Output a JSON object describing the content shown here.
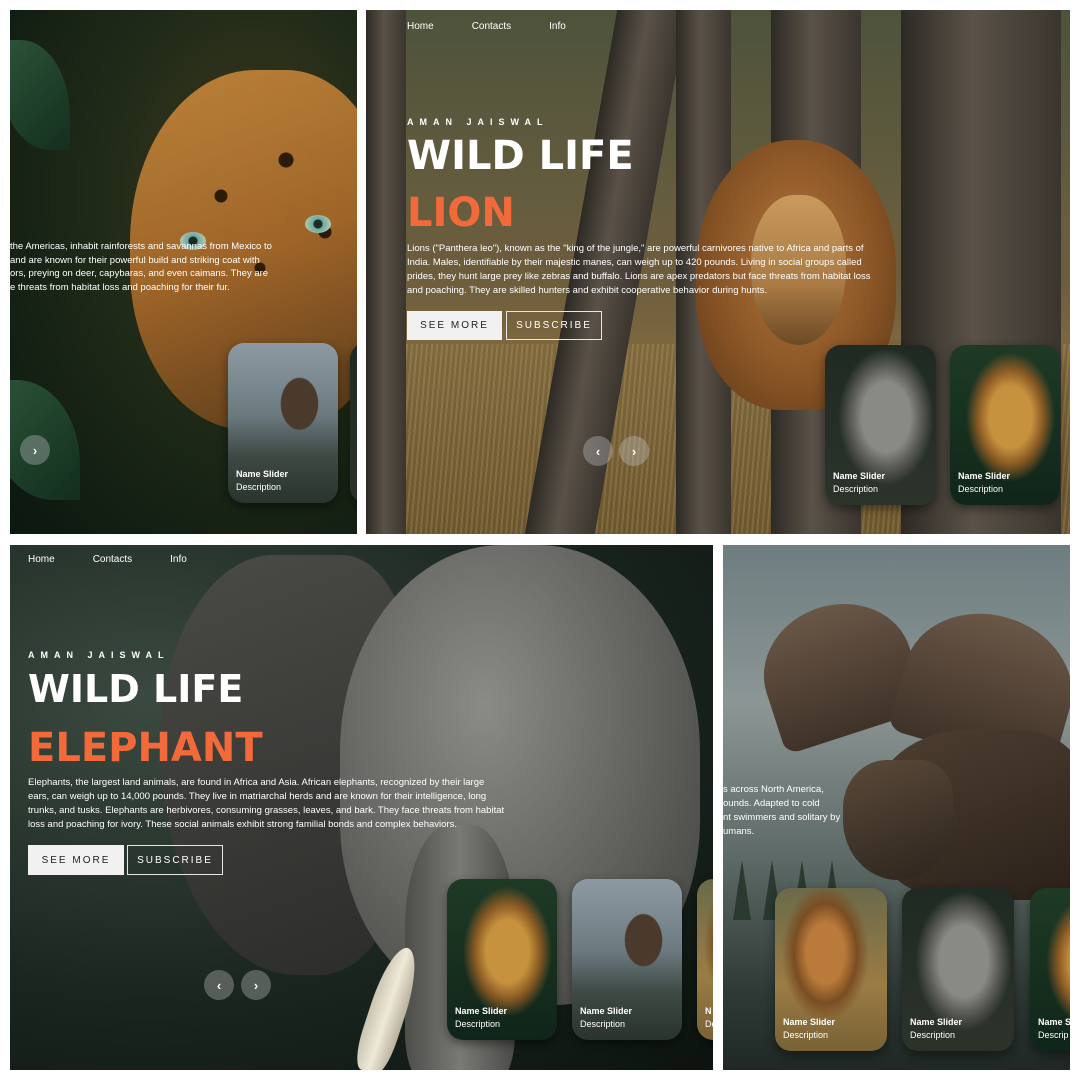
{
  "nav": {
    "home": "Home",
    "contacts": "Contacts",
    "info": "Info"
  },
  "hero": {
    "author": "AMAN JAISWAL",
    "title": "WILD LIFE",
    "see_more": "SEE MORE",
    "subscribe": "SUBSCRIBE"
  },
  "colors": {
    "accent": "#f26a3a",
    "button_light": "#f1f1f1"
  },
  "panel_a": {
    "desc_lines": [
      " the Americas, inhabit rainforests and savannas from Mexico to",
      "and are known for their powerful build and striking coat with",
      "ors, preying on deer, capybaras, and even caimans. They are",
      "e threats from habitat loss and poaching for their fur."
    ],
    "next_icon": "chevron-right-icon"
  },
  "panel_b": {
    "topic": "LION",
    "desc_lines": [
      "Lions (\"Panthera leo\"), known as the \"king of the jungle,\" are powerful carnivores native to Africa and parts of",
      "India. Males, identifiable by their majestic manes, can weigh up to 420 pounds. Living in social groups called",
      "prides, they hunt large prey like zebras and buffalo. Lions are apex predators but face threats from habitat loss",
      "and poaching. They are skilled hunters and exhibit cooperative behavior during hunts."
    ],
    "prev_icon": "chevron-left-icon",
    "next_icon": "chevron-right-icon"
  },
  "panel_c": {
    "topic": "ELEPHANT",
    "desc_lines": [
      "Elephants, the largest land animals, are found in Africa and Asia. African elephants, recognized by their large",
      "ears, can weigh up to 14,000 pounds. They live in matriarchal herds and are known for their intelligence, long",
      "trunks, and tusks. Elephants are herbivores, consuming grasses, leaves, and bark. They face threats from habitat",
      "loss and poaching for ivory. These social animals exhibit strong familial bonds and complex behaviors."
    ],
    "prev_icon": "chevron-left-icon",
    "next_icon": "chevron-right-icon"
  },
  "panel_d": {
    "desc_lines": [
      "s across North America,",
      "ounds. Adapted to cold",
      "nt swimmers and solitary by",
      "umans."
    ]
  },
  "thumbs": {
    "name": "Name Slider",
    "desc": "Description",
    "name_partial": "Name S",
    "desc_partial": "Descrip",
    "name_tiny": "N",
    "desc_tiny": "De"
  }
}
